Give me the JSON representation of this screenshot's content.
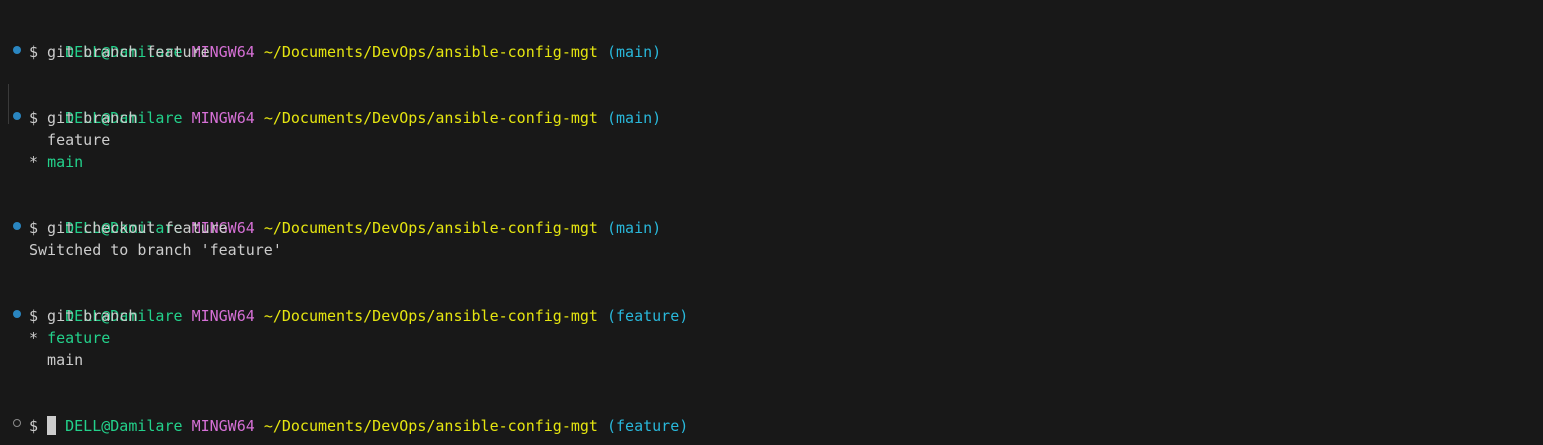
{
  "prompt": {
    "user": "DELL@Damilare",
    "host": "MINGW64",
    "path": "~/Documents/DevOps/ansible-config-mgt"
  },
  "blocks": [
    {
      "branch": "(main)",
      "command": "$ git branch feature",
      "output": []
    },
    {
      "branch": "(main)",
      "command": "$ git branch",
      "output": [
        "  feature",
        "* main"
      ]
    },
    {
      "branch": "(main)",
      "command": "$ git checkout feature",
      "output": [
        "Switched to branch 'feature'"
      ]
    },
    {
      "branch": "(feature)",
      "command": "$ git branch",
      "output": [
        "* feature",
        "  main"
      ]
    },
    {
      "branch": "(feature)",
      "command": "$ ",
      "output": []
    }
  ],
  "colors": {
    "background": "#181818",
    "user": "#23d18b",
    "host": "#d670d6",
    "path": "#e5e510",
    "branch": "#29b8db",
    "decoration": "#2a86c1"
  }
}
